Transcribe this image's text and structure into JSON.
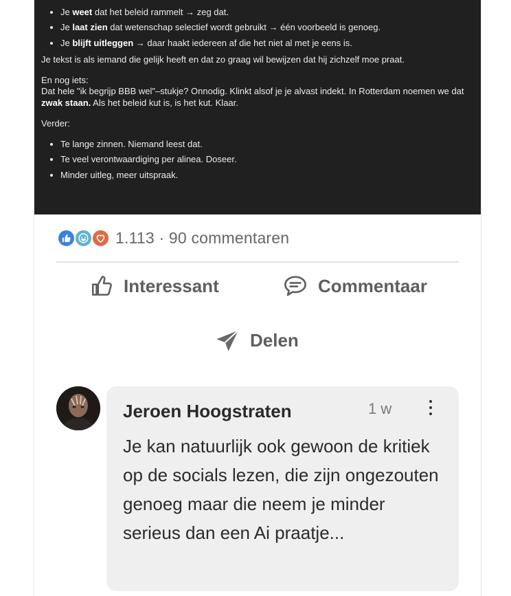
{
  "post_image": {
    "bullets_top": [
      {
        "pre": "Je ",
        "bold": "weet",
        "post": " dat het beleid rammelt → zeg dat."
      },
      {
        "pre": "Je ",
        "bold": "laat zien",
        "post": " dat wetenschap selectief wordt gebruikt → één voorbeeld is genoeg."
      },
      {
        "pre": "Je ",
        "bold": "blijft uitleggen",
        "post": " → daar haakt iedereen af die het niet al met je eens is."
      }
    ],
    "paragraph1": "Je tekst is als iemand die gelijk heeft en dat zo graag wil bewijzen dat hij zichzelf moe praat.",
    "en_nog_iets": "En nog iets:",
    "paragraph2_pre": "Dat hele \"ik begrijp BBB wel\"–stukje? Onnodig. Klinkt alsof je je alvast indekt. In Rotterdam noemen we dat ",
    "paragraph2_bold": "zwak staan.",
    "paragraph2_post": " Als het beleid kut is, is het kut. Klaar.",
    "verder": "Verder:",
    "bullets_bottom": [
      "Te lange zinnen. Niemand leest dat.",
      "Te veel verontwaardiging per alinea. Doseer.",
      "Minder uitleg, meer uitspraak."
    ]
  },
  "social": {
    "reactions_icons": [
      "like-icon",
      "funny-icon",
      "love-icon"
    ],
    "counts": "1.113 · 90 commentaren"
  },
  "actions": {
    "like": "Interessant",
    "comment": "Commentaar",
    "share": "Delen"
  },
  "comment": {
    "author": "Jeroen Hoogstraten",
    "time": "1 w",
    "text": "Je kan natuurlijk ook gewoon de kritiek op de socials lezen, die zijn ongezouten genoeg maar die neem je minder serieus dan een Ai praatje..."
  },
  "colors": {
    "like": "#3b82d9",
    "funny": "#5fb3c9",
    "love": "#e06a45",
    "bubble": "#f0efef"
  }
}
